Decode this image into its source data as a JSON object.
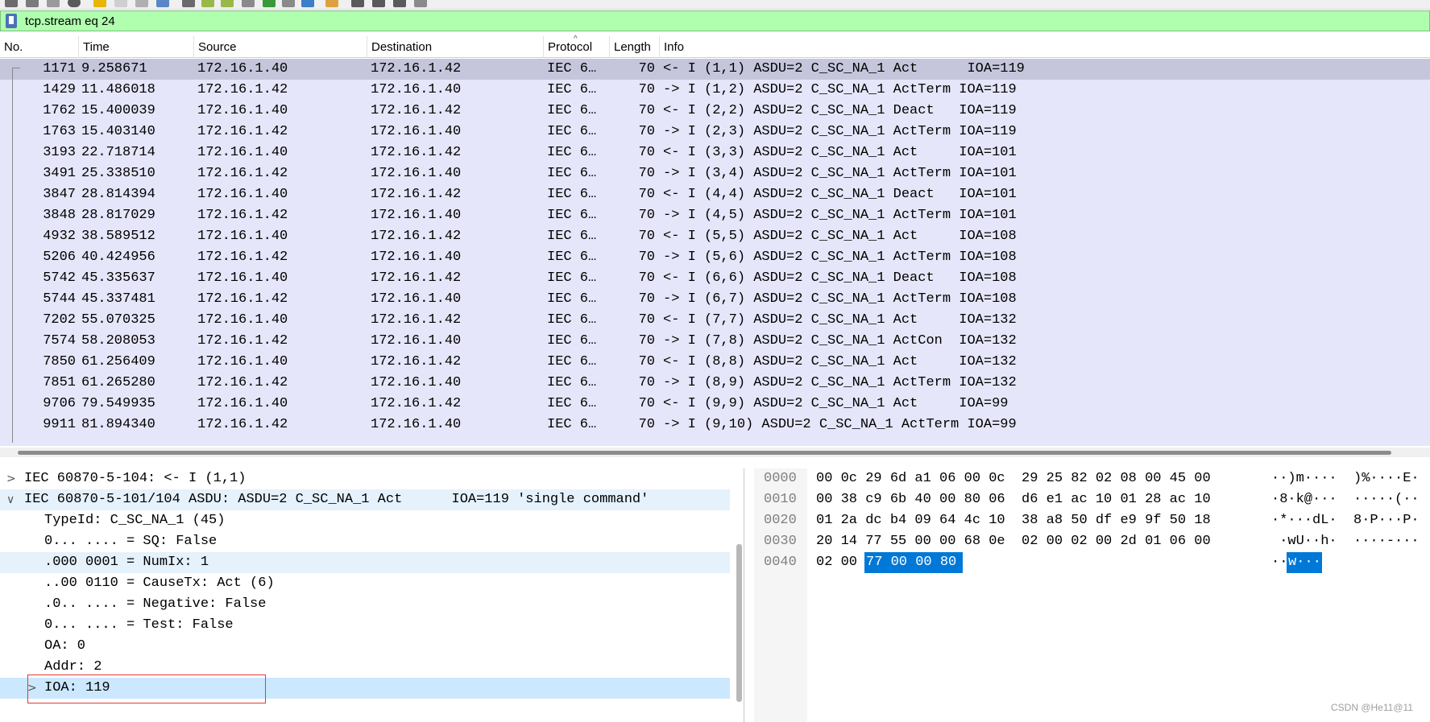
{
  "filter": {
    "text": "tcp.stream eq 24"
  },
  "packet_list": {
    "columns": [
      "No.",
      "Time",
      "Source",
      "Destination",
      "Protocol",
      "Length",
      "Info"
    ],
    "rows": [
      {
        "no": "1171",
        "time": "9.258671",
        "src": "172.16.1.40",
        "dst": "172.16.1.42",
        "proto": "IEC 6…",
        "len": "70",
        "info": "<- I (1,1) ASDU=2 C_SC_NA_1 Act      IOA=119"
      },
      {
        "no": "1429",
        "time": "11.486018",
        "src": "172.16.1.42",
        "dst": "172.16.1.40",
        "proto": "IEC 6…",
        "len": "70",
        "info": "-> I (1,2) ASDU=2 C_SC_NA_1 ActTerm IOA=119"
      },
      {
        "no": "1762",
        "time": "15.400039",
        "src": "172.16.1.40",
        "dst": "172.16.1.42",
        "proto": "IEC 6…",
        "len": "70",
        "info": "<- I (2,2) ASDU=2 C_SC_NA_1 Deact   IOA=119"
      },
      {
        "no": "1763",
        "time": "15.403140",
        "src": "172.16.1.42",
        "dst": "172.16.1.40",
        "proto": "IEC 6…",
        "len": "70",
        "info": "-> I (2,3) ASDU=2 C_SC_NA_1 ActTerm IOA=119"
      },
      {
        "no": "3193",
        "time": "22.718714",
        "src": "172.16.1.40",
        "dst": "172.16.1.42",
        "proto": "IEC 6…",
        "len": "70",
        "info": "<- I (3,3) ASDU=2 C_SC_NA_1 Act     IOA=101"
      },
      {
        "no": "3491",
        "time": "25.338510",
        "src": "172.16.1.42",
        "dst": "172.16.1.40",
        "proto": "IEC 6…",
        "len": "70",
        "info": "-> I (3,4) ASDU=2 C_SC_NA_1 ActTerm IOA=101"
      },
      {
        "no": "3847",
        "time": "28.814394",
        "src": "172.16.1.40",
        "dst": "172.16.1.42",
        "proto": "IEC 6…",
        "len": "70",
        "info": "<- I (4,4) ASDU=2 C_SC_NA_1 Deact   IOA=101"
      },
      {
        "no": "3848",
        "time": "28.817029",
        "src": "172.16.1.42",
        "dst": "172.16.1.40",
        "proto": "IEC 6…",
        "len": "70",
        "info": "-> I (4,5) ASDU=2 C_SC_NA_1 ActTerm IOA=101"
      },
      {
        "no": "4932",
        "time": "38.589512",
        "src": "172.16.1.40",
        "dst": "172.16.1.42",
        "proto": "IEC 6…",
        "len": "70",
        "info": "<- I (5,5) ASDU=2 C_SC_NA_1 Act     IOA=108"
      },
      {
        "no": "5206",
        "time": "40.424956",
        "src": "172.16.1.42",
        "dst": "172.16.1.40",
        "proto": "IEC 6…",
        "len": "70",
        "info": "-> I (5,6) ASDU=2 C_SC_NA_1 ActTerm IOA=108"
      },
      {
        "no": "5742",
        "time": "45.335637",
        "src": "172.16.1.40",
        "dst": "172.16.1.42",
        "proto": "IEC 6…",
        "len": "70",
        "info": "<- I (6,6) ASDU=2 C_SC_NA_1 Deact   IOA=108"
      },
      {
        "no": "5744",
        "time": "45.337481",
        "src": "172.16.1.42",
        "dst": "172.16.1.40",
        "proto": "IEC 6…",
        "len": "70",
        "info": "-> I (6,7) ASDU=2 C_SC_NA_1 ActTerm IOA=108"
      },
      {
        "no": "7202",
        "time": "55.070325",
        "src": "172.16.1.40",
        "dst": "172.16.1.42",
        "proto": "IEC 6…",
        "len": "70",
        "info": "<- I (7,7) ASDU=2 C_SC_NA_1 Act     IOA=132"
      },
      {
        "no": "7574",
        "time": "58.208053",
        "src": "172.16.1.42",
        "dst": "172.16.1.40",
        "proto": "IEC 6…",
        "len": "70",
        "info": "-> I (7,8) ASDU=2 C_SC_NA_1 ActCon  IOA=132"
      },
      {
        "no": "7850",
        "time": "61.256409",
        "src": "172.16.1.40",
        "dst": "172.16.1.42",
        "proto": "IEC 6…",
        "len": "70",
        "info": "<- I (8,8) ASDU=2 C_SC_NA_1 Act     IOA=132"
      },
      {
        "no": "7851",
        "time": "61.265280",
        "src": "172.16.1.42",
        "dst": "172.16.1.40",
        "proto": "IEC 6…",
        "len": "70",
        "info": "-> I (8,9) ASDU=2 C_SC_NA_1 ActTerm IOA=132"
      },
      {
        "no": "9706",
        "time": "79.549935",
        "src": "172.16.1.40",
        "dst": "172.16.1.42",
        "proto": "IEC 6…",
        "len": "70",
        "info": "<- I (9,9) ASDU=2 C_SC_NA_1 Act     IOA=99"
      },
      {
        "no": "9911",
        "time": "81.894340",
        "src": "172.16.1.42",
        "dst": "172.16.1.40",
        "proto": "IEC 6…",
        "len": "70",
        "info": "-> I (9,10) ASDU=2 C_SC_NA_1 ActTerm IOA=99"
      }
    ]
  },
  "details": {
    "rows": [
      {
        "arrow": ">",
        "text": "IEC 60870-5-104: <- I (1,1)"
      },
      {
        "arrow": "∨",
        "text": "IEC 60870-5-101/104 ASDU: ASDU=2 C_SC_NA_1 Act      IOA=119 'single command'"
      },
      {
        "arrow": "",
        "text": "TypeId: C_SC_NA_1 (45)"
      },
      {
        "arrow": "",
        "text": "0... .... = SQ: False"
      },
      {
        "arrow": "",
        "text": ".000 0001 = NumIx: 1"
      },
      {
        "arrow": "",
        "text": "..00 0110 = CauseTx: Act (6)"
      },
      {
        "arrow": "",
        "text": ".0.. .... = Negative: False"
      },
      {
        "arrow": "",
        "text": "0... .... = Test: False"
      },
      {
        "arrow": "",
        "text": "OA: 0"
      },
      {
        "arrow": "",
        "text": "Addr: 2"
      },
      {
        "arrow": ">",
        "text": "IOA: 119"
      }
    ]
  },
  "bytes": {
    "rows": [
      {
        "offset": "0000",
        "hex": "00 0c 29 6d a1 06 00 0c  29 25 82 02 08 00 45 00",
        "ascii": "··)m····  )%····E·"
      },
      {
        "offset": "0010",
        "hex": "00 38 c9 6b 40 00 80 06  d6 e1 ac 10 01 28 ac 10",
        "ascii": "·8·k@···  ·····(··"
      },
      {
        "offset": "0020",
        "hex": "01 2a dc b4 09 64 4c 10  38 a8 50 df e9 9f 50 18",
        "ascii": "·*···dL·  8·P···P·"
      },
      {
        "offset": "0030",
        "hex": "20 14 77 55 00 00 68 0e  02 00 02 00 2d 01 06 00",
        "ascii": " ·wU··h·  ····-···"
      },
      {
        "offset": "0040",
        "hex": "02 00 ",
        "ascii": "··"
      }
    ],
    "highlight_hex": "77 00 00 80",
    "highlight_ascii": "w···"
  },
  "watermark": "CSDN @He11@11",
  "colors": {
    "filter_bg": "#afffaf",
    "row_bg": "#e6e6fa",
    "selected_row_bg": "#c5c5dc",
    "byte_highlight": "#0078d7",
    "annotation_box": "#e53935"
  }
}
